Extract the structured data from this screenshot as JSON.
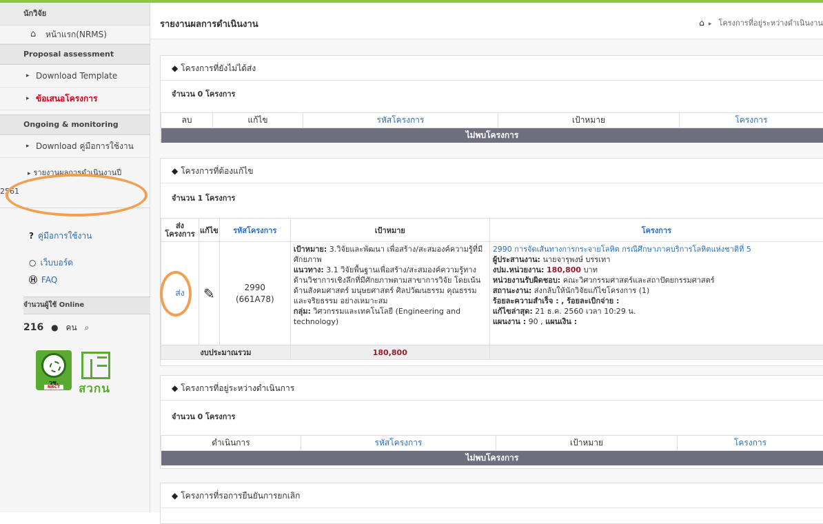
{
  "sidebar": {
    "header": "นักวิจัย",
    "home_label": "หน้าแรก(NRMS)",
    "section1": "Proposal assessment",
    "item_template": "Download Template",
    "item_proposal": "ข้อเสนอโครงการ",
    "section2": "Ongoing & monitoring",
    "item_manual": "Download คู่มือการใช้งาน",
    "item_report_line1": "รายงานผลการดำเนินงานปี",
    "item_report_line2": "2561",
    "link_manual": "คู่มือการใช้งาน",
    "link_webboard": "เว็บบอร์ด",
    "link_faq": "FAQ",
    "online_header": "จำนวนผู้ใช้ Online",
    "online_count": "216",
    "online_unit": "คน",
    "logo1_text": "วช.",
    "logo1_sub": "NRCT",
    "logo2_text": "สวกน"
  },
  "header": {
    "title": "รายงานผลการดำเนินงาน",
    "breadcrumb": "โครงการที่อยู่ระหว่างดำเนินงาน"
  },
  "panel1": {
    "title": "โครงการที่ยังไม่ได้ส่ง",
    "count": "จำนวน 0 โครงการ",
    "columns": [
      "ลบ",
      "แก้ไข",
      "รหัสโครงการ",
      "เป้าหมาย",
      "โครงการ"
    ],
    "empty": "ไม่พบโครงการ"
  },
  "panel2": {
    "title": "โครงการที่ต้องแก้ไข",
    "count": "จำนวน 1 โครงการ",
    "col_send": "ส่ง โครงการ",
    "col_edit": "แก้ไข",
    "col_code": "รหัสโครงการ",
    "col_goal": "เป้าหมาย",
    "col_project": "โครงการ",
    "row": {
      "send": "ส่ง",
      "code1": "2990",
      "code2": "(661A78)",
      "goal_label": "เป้าหมาย:",
      "goal": "3.วิจัยและพัฒนา เพื่อสร้าง/สะสมองค์ความรู้ที่มีศักยภาพ",
      "approach_label": "แนวทาง:",
      "approach": "3.1 วิจัยพื้นฐานเพื่อสร้าง/สะสมองค์ความรู้ทางด้านวิชาการเชิงลึกที่มีศักยภาพตามสาขาการวิจัย โดยเน้นด้านสังคมศาสตร์ มนุษยศาสตร์ ศิลปวัฒนธรรม คุณธรรมและจริยธรรม อย่างเหมาะสม",
      "group_label": "กลุ่ม:",
      "group": "วิศวกรรมและเทคโนโลยี (Engineering and technology)",
      "project_title": "2990 การจัดเส้นทางการกระจายโลหิต กรณีศึกษาภาคบริการโลหิตแห่งชาติที่ 5",
      "coordinator_label": "ผู้ประสานงาน:",
      "coordinator": "นายจารุพงษ์ บรรเทา",
      "budget_label": "งปม.หน่วยงาน:",
      "budget": "180,800",
      "budget_unit": "บาท",
      "unit_label": "หน่วยงานรับผิดชอบ:",
      "unit": "คณะวิศวกรรมศาสตร์และสถาปัตยกรรมศาสตร์",
      "status_label": "สถานะงาน:",
      "status": "ส่งกลับให้นักวิจัยแก้ไขโครงการ (1)",
      "percent_label": "ร้อยละความสำเร็จ :",
      "percent_label2": ", ร้อยละเบิกจ่าย :",
      "lastedit_label": "แก้ไขล่าสุด:",
      "lastedit": "21 ธ.ค. 2560 เวลา 10:29 น.",
      "plan_label": "แผนงาน :",
      "plan": "90 ,",
      "plan_money_label": "แผนเงิน :"
    },
    "total_label": "งบประมาณรวม",
    "total": "180,800"
  },
  "panel3": {
    "title": "โครงการที่อยู่ระหว่างดำเนินการ",
    "count": "จำนวน 0 โครงการ",
    "columns": [
      "ดำเนินการ",
      "รหัสโครงการ",
      "เป้าหมาย",
      "โครงการ"
    ],
    "empty": "ไม่พบโครงการ"
  },
  "panel4": {
    "title": "โครงการที่รอการยืนยันการยกเลิก"
  }
}
